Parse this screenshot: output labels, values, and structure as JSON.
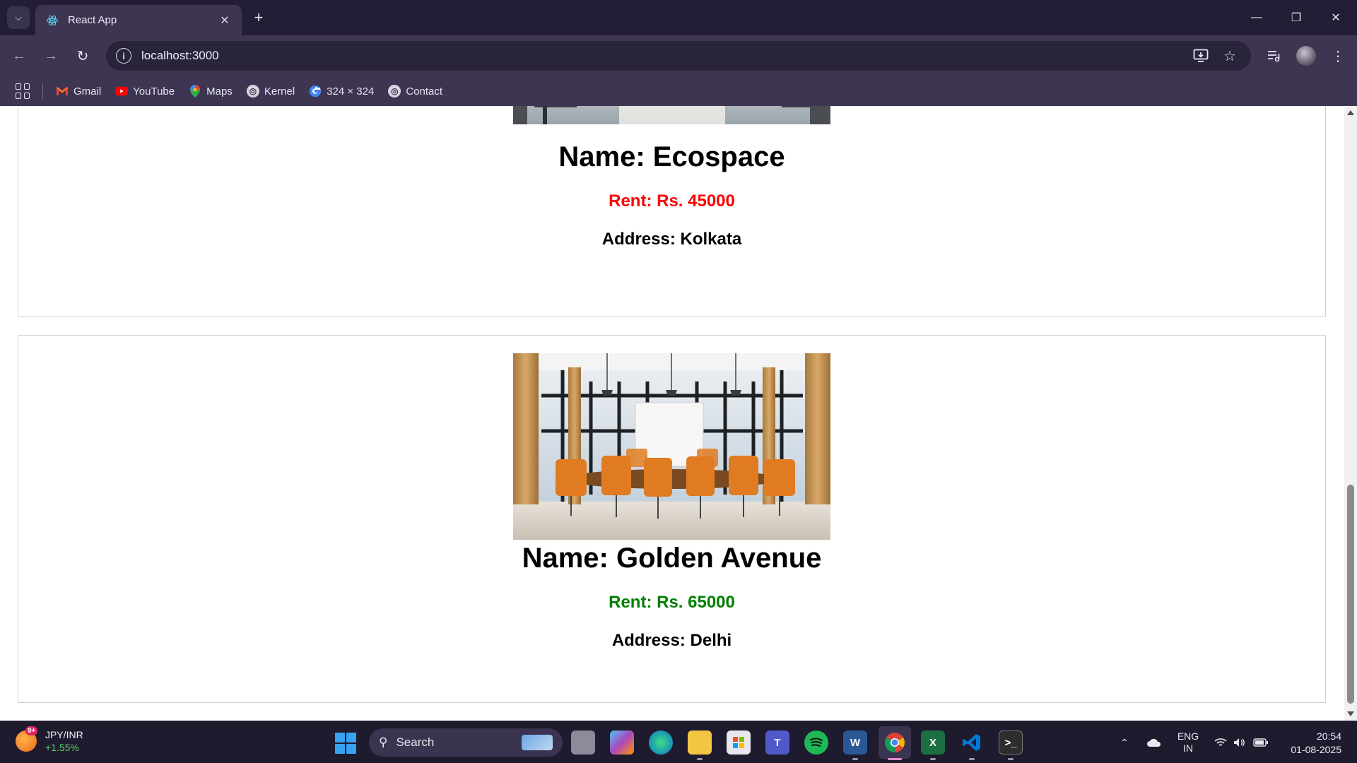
{
  "browser": {
    "tab_title": "React App",
    "url": "localhost:3000",
    "bookmarks": [
      {
        "label": "Gmail"
      },
      {
        "label": "YouTube"
      },
      {
        "label": "Maps"
      },
      {
        "label": "Kernel"
      },
      {
        "label": "324 × 324"
      },
      {
        "label": "Contact"
      }
    ]
  },
  "listings": [
    {
      "name": "Name: Ecospace",
      "rent": "Rent: Rs. 45000",
      "rent_color": "#ff0000",
      "address": "Address: Kolkata"
    },
    {
      "name": "Name: Golden Avenue",
      "rent": "Rent: Rs. 65000",
      "rent_color": "#008000",
      "address": "Address: Delhi"
    }
  ],
  "taskbar": {
    "widget_title": "JPY/INR",
    "widget_change": "+1.55%",
    "widget_badge": "9+",
    "search_label": "Search",
    "lang_top": "ENG",
    "lang_bottom": "IN",
    "time": "20:54",
    "date": "01-08-2025"
  }
}
